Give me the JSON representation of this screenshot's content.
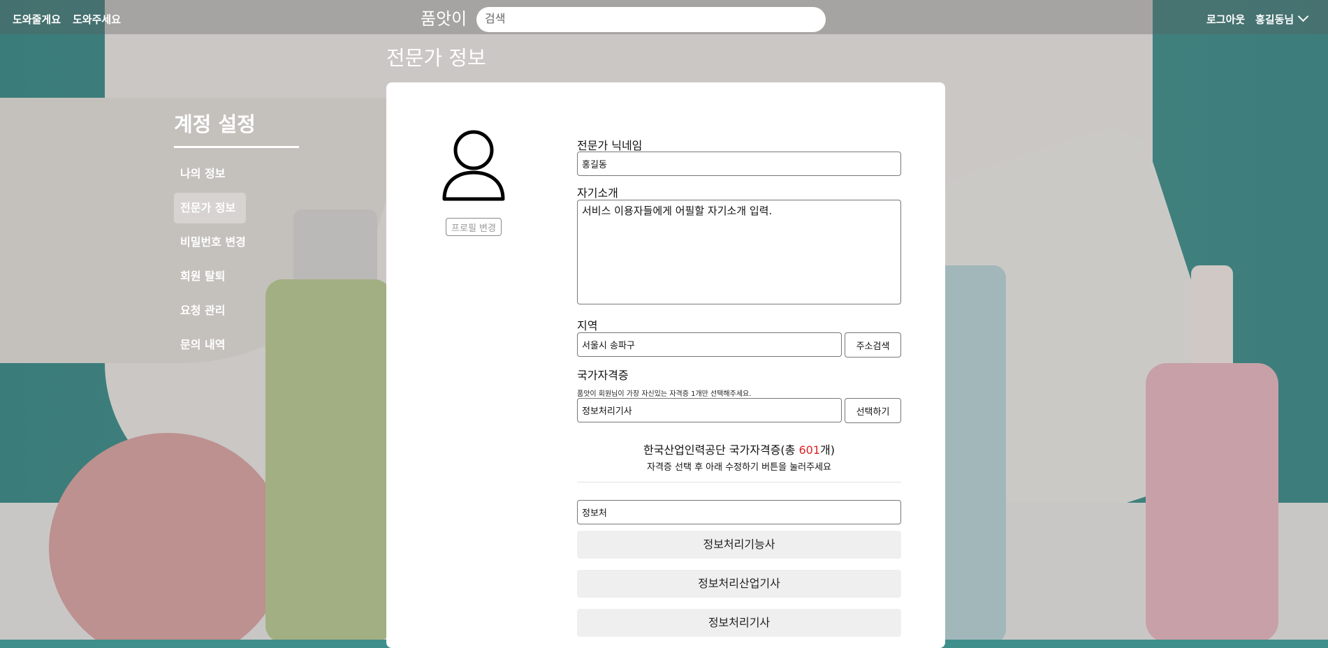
{
  "header": {
    "links": [
      "도와줄게요",
      "도와주세요"
    ],
    "logo": "품앗이",
    "search_placeholder": "검색",
    "logout": "로그아웃",
    "user": "홍길동님"
  },
  "page_title": "전문가 정보",
  "sidebar": {
    "title": "계정 설정",
    "items": [
      {
        "label": "나의 정보"
      },
      {
        "label": "전문가 정보"
      },
      {
        "label": "비밀번호 변경"
      },
      {
        "label": "회원 탈퇴"
      },
      {
        "label": "요청 관리"
      },
      {
        "label": "문의 내역"
      }
    ],
    "active_index": 1
  },
  "profile": {
    "change_button": "프로필 변경"
  },
  "form": {
    "nickname_label": "전문가 닉네임",
    "nickname_value": "홍길동",
    "intro_label": "자기소개",
    "intro_value": "서비스 이용자들에게 어필할 자기소개 입력.",
    "region_label": "지역",
    "region_value": "서울시 송파구",
    "address_button": "주소검색",
    "cert_label": "국가자격증",
    "cert_hint": "품앗이 회원님이 가장 자신있는 자격증 1개만 선택해주세요.",
    "cert_value": "정보처리기사",
    "select_button": "선택하기"
  },
  "cert_panel": {
    "title_prefix": "한국산업인력공단 국가자격증(총 ",
    "count": "601",
    "title_suffix": "개)",
    "subtitle": "자격증 선택 후 아래 수정하기 버튼을 눌러주세요",
    "search_value": "정보처",
    "results": [
      "정보처리기능사",
      "정보처리산업기사",
      "정보처리기사"
    ]
  }
}
